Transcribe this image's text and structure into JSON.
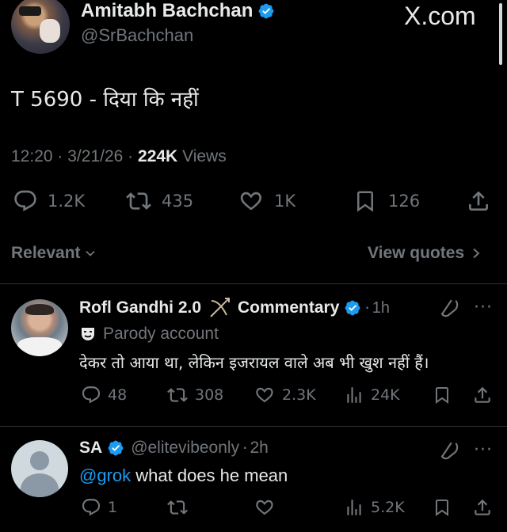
{
  "main_tweet": {
    "author_name": "Amitabh Bachchan",
    "handle": "@SrBachchan",
    "watermark": "X.com",
    "text": "T 5690 - दिया कि नहीं",
    "time": "12:20",
    "date": "3/21/26",
    "views_count": "224K",
    "views_label": "Views",
    "stats": {
      "replies": "1.2K",
      "reposts": "435",
      "likes": "1K",
      "bookmarks": "126"
    }
  },
  "filter_bar": {
    "sort_label": "Relevant",
    "quotes_label": "View quotes"
  },
  "replies": [
    {
      "author_name": "Rofl Gandhi 2.0",
      "name_suffix": "Commentary",
      "time": "1h",
      "parody_label": "Parody account",
      "text": "देकर तो आया था, लेकिन इजरायल वाले अब भी खुश नहीं हैं।",
      "stats": {
        "replies": "48",
        "reposts": "308",
        "likes": "2.3K",
        "views": "24K"
      }
    },
    {
      "author_name": "SA",
      "handle": "@elitevibeonly",
      "time": "2h",
      "mention": "@grok",
      "text": "what does he mean",
      "stats": {
        "replies": "1",
        "reposts": "",
        "likes": "",
        "views": "5.2K"
      }
    }
  ],
  "colors": {
    "background": "#000000",
    "text": "#e7e9ea",
    "muted": "#71767b",
    "verified": "#1d9bf0",
    "link": "#1d9bf0",
    "divider": "#2f3336"
  }
}
